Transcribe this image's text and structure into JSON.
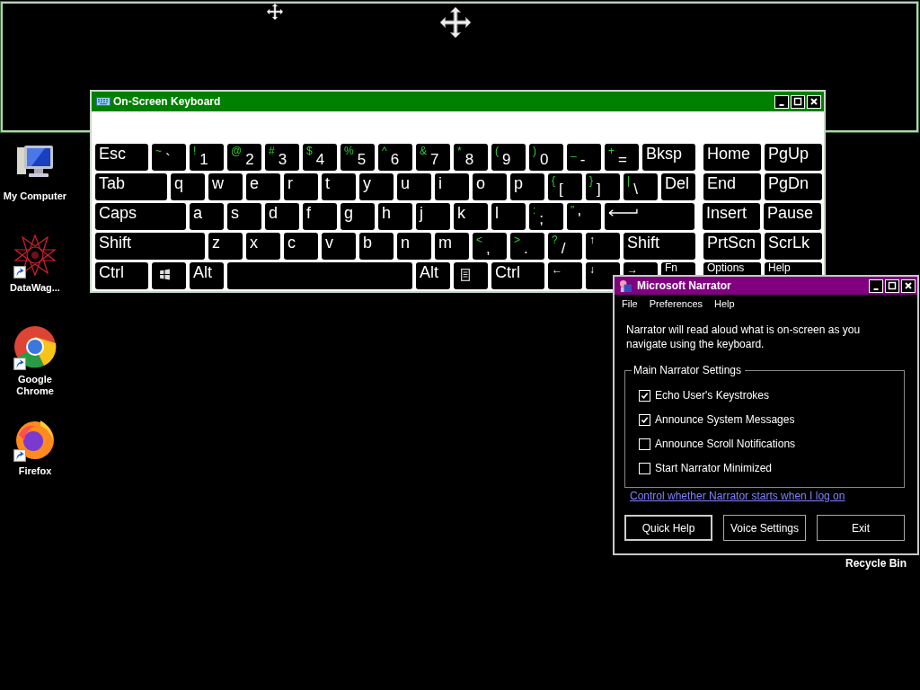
{
  "desktop_icons": [
    {
      "label": "My Computer",
      "kind": "computer",
      "shortcut": false
    },
    {
      "label": "DataWag...",
      "kind": "star",
      "shortcut": true
    },
    {
      "label": "Google Chrome",
      "kind": "chrome",
      "shortcut": true
    },
    {
      "label": "Firefox",
      "kind": "firefox",
      "shortcut": true
    }
  ],
  "recycle_bin": {
    "label": "Recycle Bin"
  },
  "keyboard": {
    "title": "On-Screen Keyboard",
    "rows": [
      {
        "keys": [
          {
            "label": "Esc",
            "kind": "wide"
          },
          {
            "shift": "~",
            "label": "`",
            "kind": "std"
          },
          {
            "shift": "!",
            "label": "1",
            "kind": "std"
          },
          {
            "shift": "@",
            "label": "2",
            "kind": "std"
          },
          {
            "shift": "#",
            "label": "3",
            "kind": "std"
          },
          {
            "shift": "$",
            "label": "4",
            "kind": "std"
          },
          {
            "shift": "%",
            "label": "5",
            "kind": "std"
          },
          {
            "shift": "^",
            "label": "6",
            "kind": "std"
          },
          {
            "shift": "&",
            "label": "7",
            "kind": "std"
          },
          {
            "shift": "*",
            "label": "8",
            "kind": "std"
          },
          {
            "shift": "(",
            "label": "9",
            "kind": "std"
          },
          {
            "shift": ")",
            "label": "0",
            "kind": "std"
          },
          {
            "shift": "_",
            "label": "-",
            "kind": "std"
          },
          {
            "shift": "+",
            "label": "=",
            "kind": "std"
          },
          {
            "label": "Bksp",
            "kind": "wide"
          }
        ],
        "nav": [
          {
            "label": "Home",
            "kind": "nav"
          },
          {
            "label": "PgUp",
            "kind": "nav"
          }
        ]
      },
      {
        "keys": [
          {
            "label": "Tab",
            "kind": "double"
          },
          {
            "label": "q",
            "kind": "std"
          },
          {
            "label": "w",
            "kind": "std"
          },
          {
            "label": "e",
            "kind": "std"
          },
          {
            "label": "r",
            "kind": "std"
          },
          {
            "label": "t",
            "kind": "std"
          },
          {
            "label": "y",
            "kind": "std"
          },
          {
            "label": "u",
            "kind": "std"
          },
          {
            "label": "i",
            "kind": "std"
          },
          {
            "label": "o",
            "kind": "std"
          },
          {
            "label": "p",
            "kind": "std"
          },
          {
            "shift": "{",
            "label": "[",
            "kind": "std"
          },
          {
            "shift": "}",
            "label": "]",
            "kind": "std"
          },
          {
            "shift": "|",
            "label": "\\",
            "kind": "std"
          },
          {
            "label": "Del",
            "kind": "std"
          }
        ],
        "nav": [
          {
            "label": "End",
            "kind": "nav"
          },
          {
            "label": "PgDn",
            "kind": "nav"
          }
        ]
      },
      {
        "keys": [
          {
            "label": "Caps",
            "kind": "caps"
          },
          {
            "label": "a",
            "kind": "std"
          },
          {
            "label": "s",
            "kind": "std"
          },
          {
            "label": "d",
            "kind": "std"
          },
          {
            "label": "f",
            "kind": "std"
          },
          {
            "label": "g",
            "kind": "std"
          },
          {
            "label": "h",
            "kind": "std"
          },
          {
            "label": "j",
            "kind": "std"
          },
          {
            "label": "k",
            "kind": "std"
          },
          {
            "label": "l",
            "kind": "std"
          },
          {
            "shift": ":",
            "label": ";",
            "kind": "std"
          },
          {
            "shift": "\"",
            "label": "'",
            "kind": "std"
          },
          {
            "kind": "enter"
          }
        ],
        "nav": [
          {
            "label": "Insert",
            "kind": "nav"
          },
          {
            "label": "Pause",
            "kind": "nav"
          }
        ]
      },
      {
        "keys": [
          {
            "label": "Shift",
            "kind": "triple"
          },
          {
            "label": "z",
            "kind": "std"
          },
          {
            "label": "x",
            "kind": "std"
          },
          {
            "label": "c",
            "kind": "std"
          },
          {
            "label": "v",
            "kind": "std"
          },
          {
            "label": "b",
            "kind": "std"
          },
          {
            "label": "n",
            "kind": "std"
          },
          {
            "label": "m",
            "kind": "std"
          },
          {
            "shift": "<",
            "label": ",",
            "kind": "std"
          },
          {
            "shift": ">",
            "label": ".",
            "kind": "std"
          },
          {
            "shift": "?",
            "label": "/",
            "kind": "std"
          },
          {
            "label": "↑",
            "kind": "arrow"
          },
          {
            "label": "Shift",
            "kind": "double"
          }
        ],
        "nav": [
          {
            "label": "PrtScn",
            "kind": "nav"
          },
          {
            "label": "ScrLk",
            "kind": "nav"
          }
        ]
      },
      {
        "keys": [
          {
            "label": "Ctrl",
            "kind": "wide"
          },
          {
            "kind": "windows"
          },
          {
            "label": "Alt",
            "kind": "std"
          },
          {
            "kind": "space"
          },
          {
            "label": "Alt",
            "kind": "std"
          },
          {
            "kind": "menu"
          },
          {
            "label": "Ctrl",
            "kind": "wide"
          },
          {
            "label": "←",
            "kind": "arrow"
          },
          {
            "label": "↓",
            "kind": "arrow"
          },
          {
            "label": "→",
            "kind": "arrow"
          },
          {
            "label": "Fn",
            "kind": "std"
          }
        ],
        "nav": [
          {
            "label": "Options",
            "kind": "navsmall"
          },
          {
            "label": "Help",
            "kind": "nav"
          }
        ]
      }
    ]
  },
  "narrator": {
    "title": "Microsoft Narrator",
    "menu": [
      "File",
      "Preferences",
      "Help"
    ],
    "description": "Narrator will read aloud what is on-screen as you navigate using the keyboard.",
    "group": {
      "title": "Main Narrator Settings",
      "options": [
        {
          "label": "Echo User's Keystrokes",
          "checked": true
        },
        {
          "label": "Announce System Messages",
          "checked": true
        },
        {
          "label": "Announce Scroll Notifications",
          "checked": false
        },
        {
          "label": "Start Narrator Minimized",
          "checked": false
        }
      ]
    },
    "link": "Control whether Narrator starts when I log on",
    "buttons": [
      {
        "label": "Quick Help",
        "default": true
      },
      {
        "label": "Voice Settings",
        "default": false
      },
      {
        "label": "Exit",
        "default": false
      }
    ]
  }
}
